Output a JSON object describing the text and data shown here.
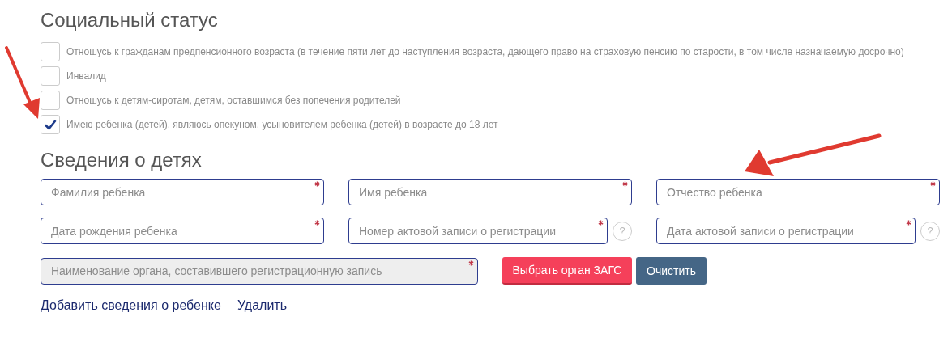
{
  "social_status": {
    "title": "Социальный статус",
    "options": [
      {
        "label": "Отношусь к гражданам предпенсионного возраста (в течение пяти лет до наступления возраста, дающего право на страховую пенсию по старости, в том числе назначаемую досрочно)",
        "checked": false
      },
      {
        "label": "Инвалид",
        "checked": false
      },
      {
        "label": "Отношусь к детям-сиротам, детям, оставшимся без попечения родителей",
        "checked": false
      },
      {
        "label": "Имею ребенка (детей), являюсь опекуном, усыновителем ребенка (детей) в возрасте до 18 лет",
        "checked": true
      }
    ]
  },
  "children": {
    "title": "Сведения о детях",
    "field_rows": [
      [
        {
          "placeholder": "Фамилия ребенка",
          "required": true,
          "disabled": false
        },
        {
          "placeholder": "Имя ребенка",
          "required": true,
          "disabled": false
        },
        {
          "placeholder": "Отчество ребенка",
          "required": true,
          "disabled": false
        }
      ],
      [
        {
          "placeholder": "Дата рождения ребенка",
          "required": true,
          "disabled": false
        },
        {
          "placeholder": "Номер актовой записи о регистрации",
          "required": true,
          "disabled": false,
          "help": "?"
        },
        {
          "placeholder": "Дата актовой записи о регистрации",
          "required": true,
          "disabled": false,
          "help": "?"
        }
      ]
    ],
    "registry": {
      "placeholder": "Наименование органа, составившего регистрационную запись",
      "required": true,
      "disabled": true
    },
    "buttons": [
      {
        "label": "Выбрать орган ЗАГС",
        "kind": "primary"
      },
      {
        "label": "Очистить",
        "kind": "secondary"
      }
    ],
    "links": [
      "Добавить сведения о ребенке",
      "Удалить"
    ]
  }
}
